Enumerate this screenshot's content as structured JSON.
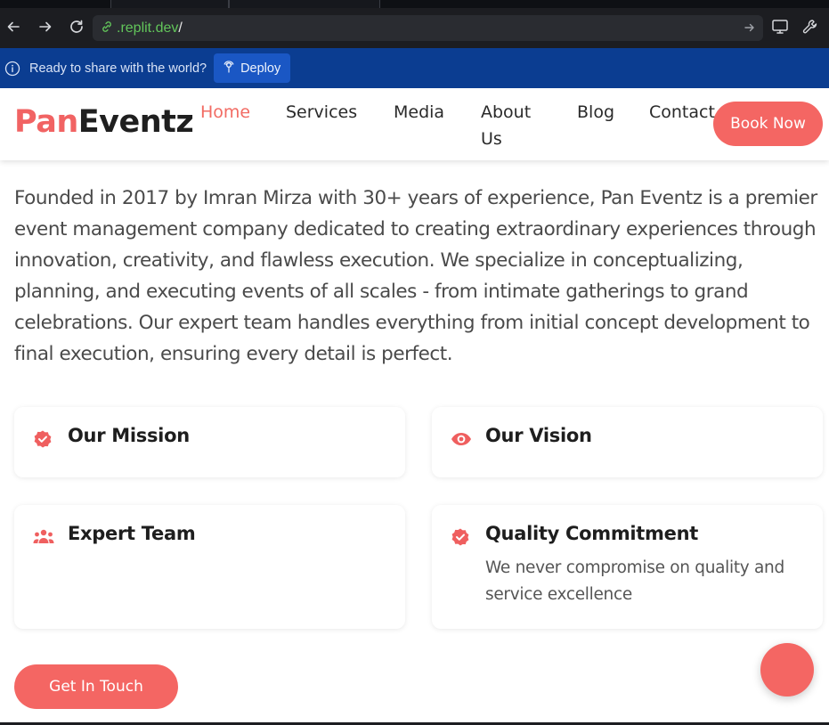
{
  "browser": {
    "url_host": ".replit.dev",
    "url_path": "/"
  },
  "banner": {
    "message": "Ready to share with the world?",
    "deploy_label": "Deploy",
    "background": "#0b3d91"
  },
  "site": {
    "logo_part1": "Pan",
    "logo_part2": "Eventz",
    "brand_color": "#f46663",
    "nav": {
      "home": "Home",
      "services": "Services",
      "media": "Media",
      "about_line1": "About",
      "about_line2": "Us",
      "blog": "Blog",
      "contact": "Contact"
    },
    "book_now": "Book Now"
  },
  "intro": "Founded in 2017 by Imran Mirza with 30+ years of experience, Pan Eventz is a premier event management company dedicated to creating extraordinary experiences through innovation, creativity, and flawless execution. We specialize in conceptualizing, planning, and executing events of all scales - from intimate gatherings to grand celebrations. Our expert team handles everything from initial concept development to final execution, ensuring every detail is perfect.",
  "cards": {
    "mission": {
      "title": "Our Mission",
      "icon": "badge-check-icon"
    },
    "vision": {
      "title": "Our Vision",
      "icon": "eye-icon"
    },
    "team": {
      "title": "Expert Team",
      "icon": "users-icon"
    },
    "quality": {
      "title": "Quality Commitment",
      "desc": "We never compromise on quality and service excellence",
      "icon": "badge-check-icon"
    }
  },
  "cta_label": "Get In Touch"
}
